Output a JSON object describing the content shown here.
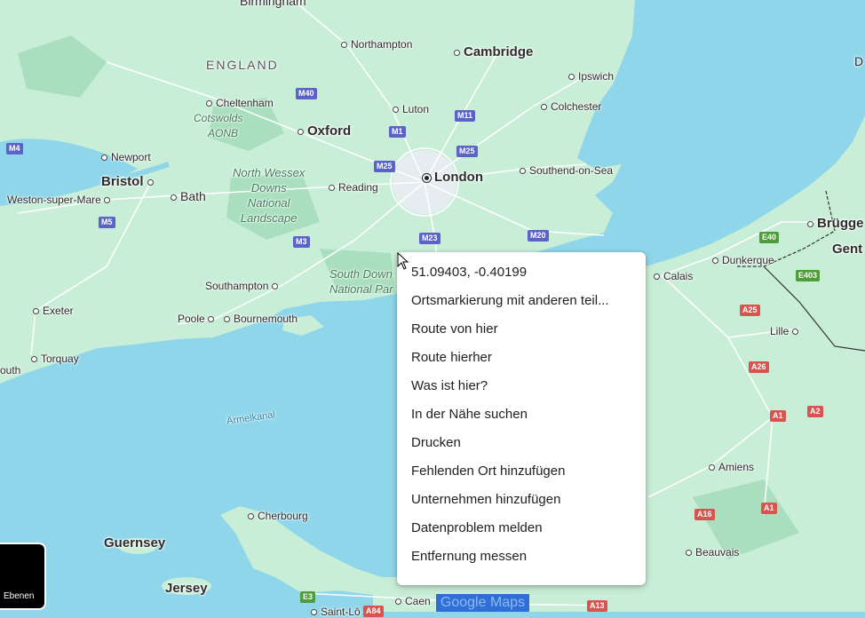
{
  "context_menu": {
    "coordinates": "51.09403, -0.40199",
    "items": [
      "Ortsmarkierung mit anderen teil...",
      "Route von hier",
      "Route hierher",
      "Was ist hier?",
      "In der Nähe suchen",
      "Drucken",
      "Fehlenden Ort hinzufügen",
      "Unternehmen hinzufügen",
      "Datenproblem melden",
      "Entfernung messen"
    ]
  },
  "layers_button": {
    "label": "Ebenen"
  },
  "logo": {
    "text": "Google Maps"
  },
  "map_labels": {
    "birmingham": "Birmingham",
    "northampton": "Northampton",
    "cambridge": "Cambridge",
    "england": "ENGLAND",
    "ipswich": "Ipswich",
    "cheltenham": "Cheltenham",
    "cotswolds": "Cotswolds",
    "aonb": "AONB",
    "luton": "Luton",
    "colchester": "Colchester",
    "oxford": "Oxford",
    "newport": "Newport",
    "bristol": "Bristol",
    "north_wessex": "North Wessex",
    "downs": "Downs",
    "national": "National",
    "landscape": "Landscape",
    "london": "London",
    "southend": "Southend-on-Sea",
    "reading": "Reading",
    "bath": "Bath",
    "weston": "Weston-super-Mare",
    "southampton": "Southampton",
    "south_downs": "South Down",
    "national_park": "National Par",
    "poole": "Poole",
    "bournemouth": "Bournemouth",
    "exeter": "Exeter",
    "torquay": "Torquay",
    "plymouth": "outh",
    "aermelkanal": "Ärmelkanal",
    "cherbourg": "Cherbourg",
    "guernsey": "Guernsey",
    "jersey": "Jersey",
    "caen": "Caen",
    "saint_lo": "Saint-Lô",
    "calais": "Calais",
    "dunkerque": "Dunkerque",
    "lille": "Lille",
    "brugge": "Brügge",
    "gent": "Gent",
    "amiens": "Amiens",
    "beauvais": "Beauvais",
    "edge_d": "D"
  },
  "road_shields": {
    "m40": "M40",
    "m4": "M4",
    "m11": "M11",
    "m1": "M1",
    "m25a": "M25",
    "m25b": "M25",
    "m5": "M5",
    "m3": "M3",
    "m23": "M23",
    "m20": "M20",
    "a25": "A25",
    "a26": "A26",
    "a1a": "A1",
    "a2": "A2",
    "a16": "A16",
    "a1b": "A1",
    "a13": "A13",
    "a84": "A84",
    "e40": "E40",
    "e403": "E403",
    "e3": "E3"
  },
  "colors": {
    "water": "#8fd6ea",
    "land": "#c9eed7",
    "menu_bg": "#ffffff",
    "motorway": "#5b63c9",
    "a_road": "#d9544f",
    "e_road": "#4d9d3a"
  }
}
